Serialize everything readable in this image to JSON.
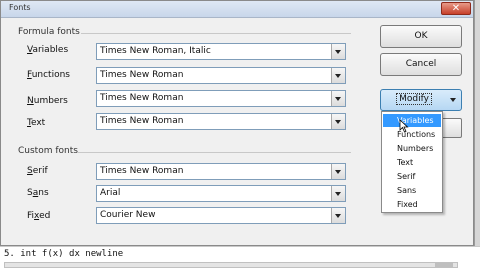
{
  "window": {
    "title": "Fonts",
    "close_glyph": "✕"
  },
  "formula_fonts": {
    "heading": "Formula fonts",
    "rows": [
      {
        "pre": "",
        "ul": "V",
        "post": "ariables",
        "value": "Times New Roman, Italic"
      },
      {
        "pre": "",
        "ul": "F",
        "post": "unctions",
        "value": "Times New Roman"
      },
      {
        "pre": "",
        "ul": "N",
        "post": "umbers",
        "value": "Times New Roman"
      },
      {
        "pre": "",
        "ul": "T",
        "post": "ext",
        "value": "Times New Roman"
      }
    ]
  },
  "custom_fonts": {
    "heading": "Custom fonts",
    "rows": [
      {
        "pre": "",
        "ul": "S",
        "post": "erif",
        "value": "Times New Roman"
      },
      {
        "pre": "S",
        "ul": "a",
        "post": "ns",
        "value": "Arial"
      },
      {
        "pre": "Fi",
        "ul": "x",
        "post": "ed",
        "value": "Courier New"
      }
    ]
  },
  "buttons": {
    "ok": "OK",
    "cancel": "Cancel",
    "modify": "Modify"
  },
  "modify_menu": {
    "items": [
      "Variables",
      "Functions",
      "Numbers",
      "Text",
      "Serif",
      "Sans",
      "Fixed"
    ],
    "selected": "Variables"
  },
  "editor": {
    "line": "5. int f(x) dx newline"
  },
  "colors": {
    "selection": "#3399ff",
    "modify_border": "#3c7fb1"
  }
}
